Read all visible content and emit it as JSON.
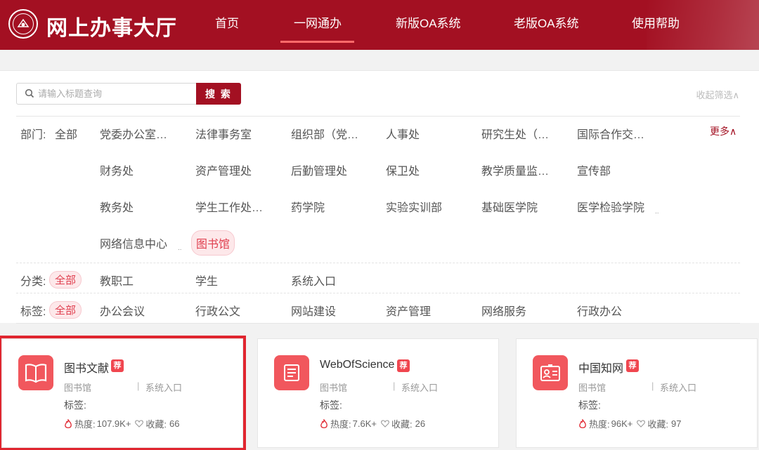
{
  "header": {
    "site_title": "网上办事大厅",
    "nav": [
      "首页",
      "一网通办",
      "新版OA系统",
      "老版OA系统",
      "使用帮助"
    ],
    "active_nav": "一网通办"
  },
  "search": {
    "placeholder": "请输入标题查询",
    "button_label": "搜 索",
    "collapse_label": "收起筛选∧"
  },
  "filters": {
    "dept_label": "部门:",
    "dept_all": "全部",
    "dept_more": "更多∧",
    "depts": [
      "党委办公室…",
      "法律事务室",
      "组织部（党…",
      "人事处",
      "研究生处（…",
      "国际合作交…",
      "财务处",
      "资产管理处",
      "后勤管理处",
      "保卫处",
      "教学质量监…",
      "宣传部",
      "教务处",
      "学生工作处…",
      "药学院",
      "实验实训部",
      "基础医学院",
      "医学检验学院",
      "网络信息中心",
      "图书馆"
    ],
    "dept_selected": "图书馆",
    "cat_label": "分类:",
    "cat_all": "全部",
    "cats": [
      "教职工",
      "学生",
      "系统入口"
    ],
    "tag_label": "标签:",
    "tag_all": "全部",
    "tags": [
      "办公会议",
      "行政公文",
      "网站建设",
      "资产管理",
      "网络服务",
      "行政办公"
    ]
  },
  "cards": [
    {
      "title": "图书文献",
      "badge": "荐",
      "dept": "图书馆",
      "sep": "|",
      "category": "系统入口",
      "tag_label": "标签:",
      "heat_label": "热度:",
      "heat": "107.9K+",
      "fav_label": "收藏:",
      "fav": "66",
      "icon": "book-icon"
    },
    {
      "title": "WebOfScience",
      "badge": "荐",
      "dept": "图书馆",
      "sep": "|",
      "category": "系统入口",
      "tag_label": "标签:",
      "heat_label": "热度:",
      "heat": "7.6K+",
      "fav_label": "收藏:",
      "fav": "26",
      "icon": "scroll-icon"
    },
    {
      "title": "中国知网",
      "badge": "荐",
      "dept": "图书馆",
      "sep": "|",
      "category": "系统入口",
      "tag_label": "标签:",
      "heat_label": "热度:",
      "heat": "96K+",
      "fav_label": "收藏:",
      "fav": "97",
      "icon": "id-card-icon"
    }
  ],
  "colors": {
    "brand": "#a31022",
    "accent": "#f1575d",
    "highlight": "#e0252f"
  }
}
